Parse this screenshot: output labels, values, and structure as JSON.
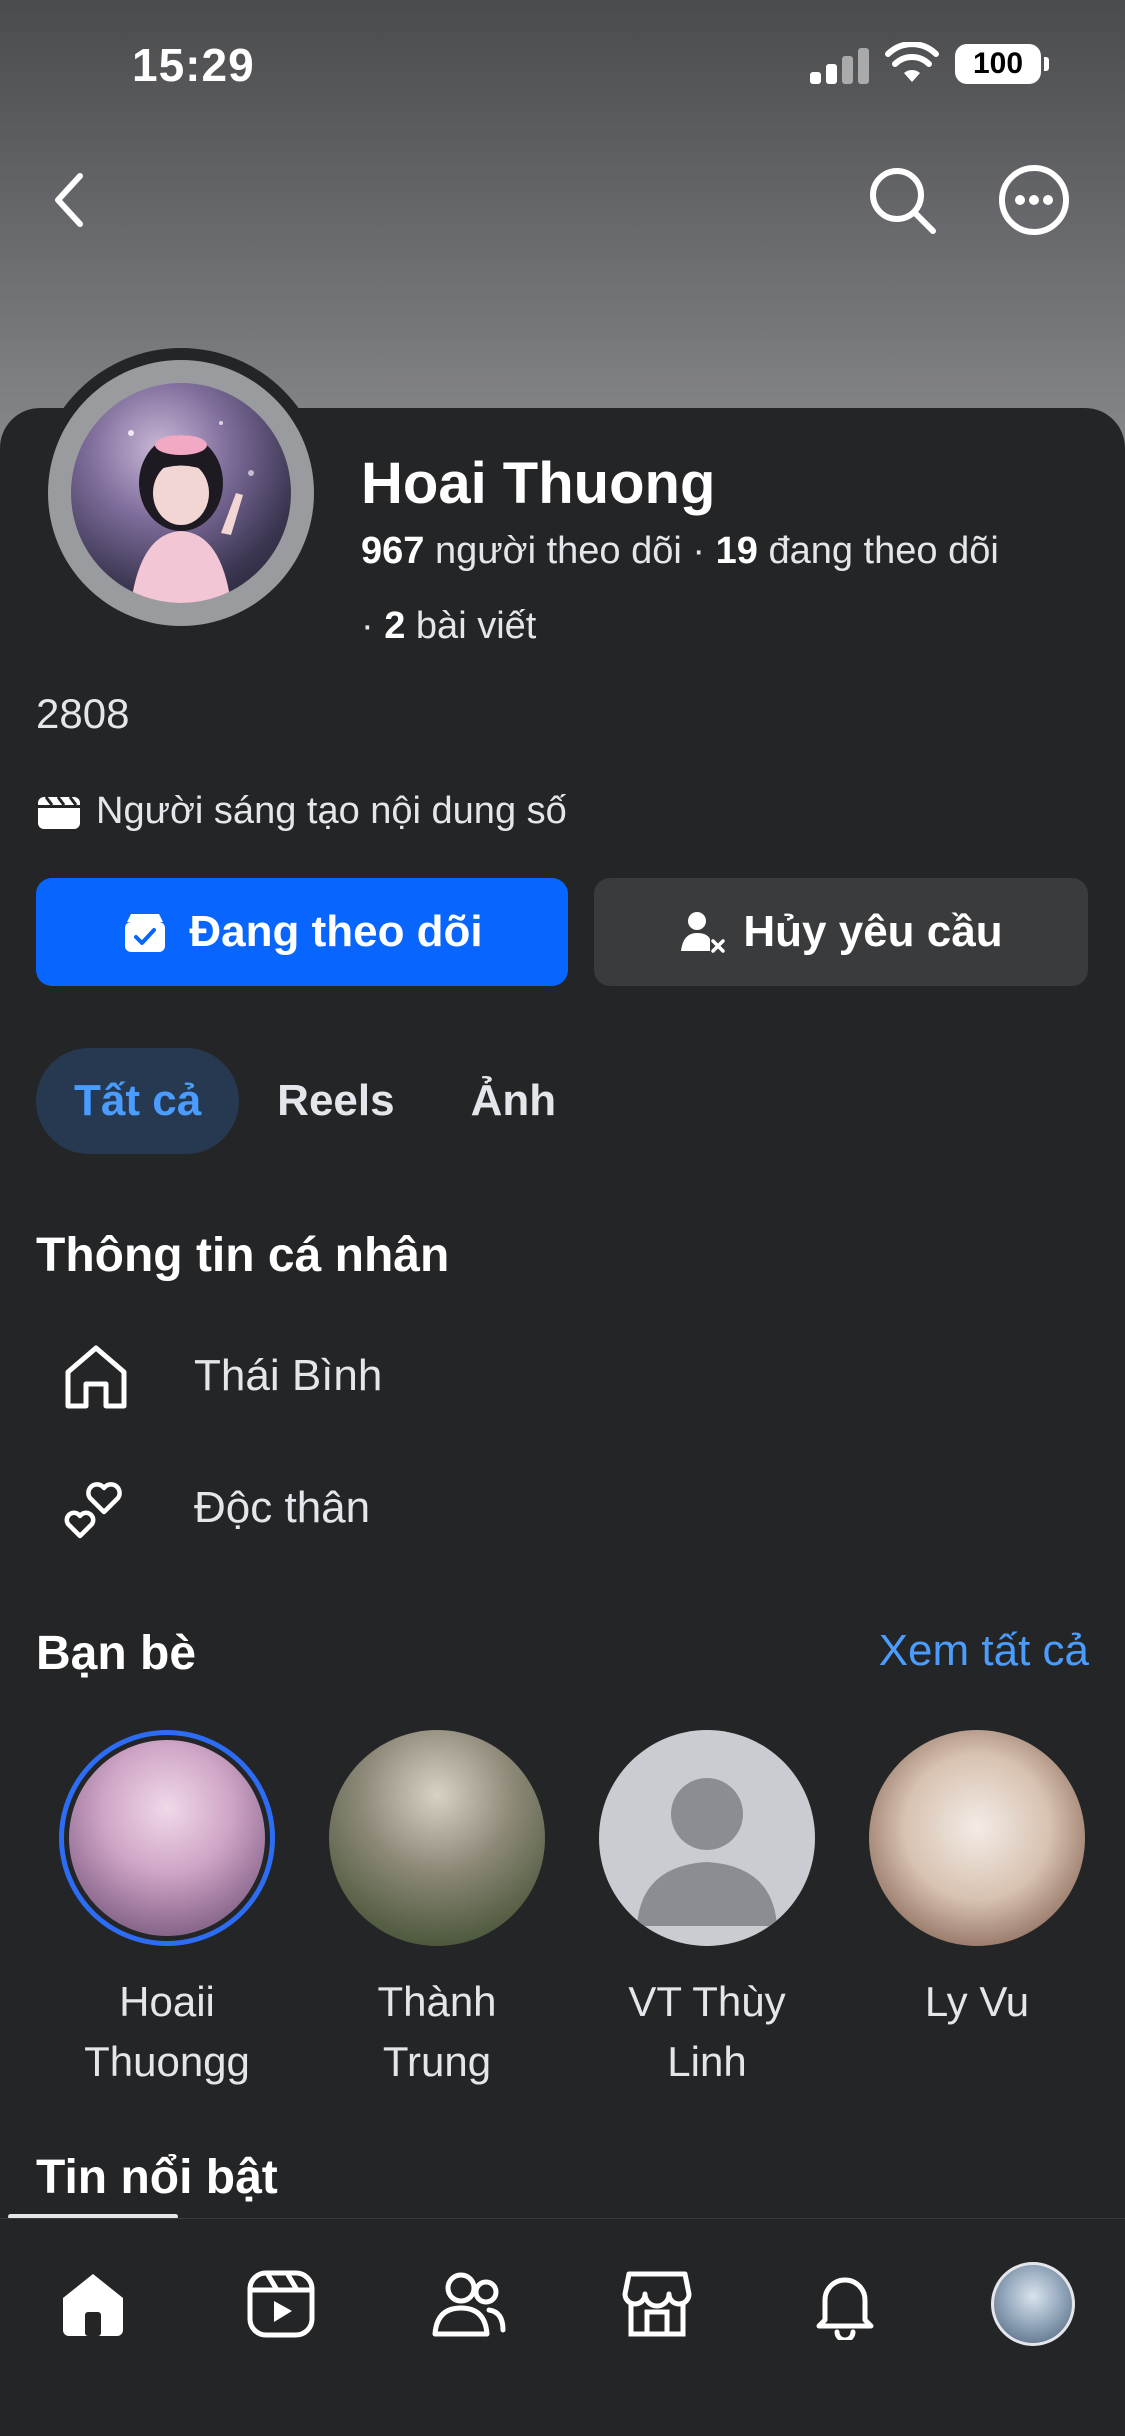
{
  "status_bar": {
    "time": "15:29",
    "battery": "100"
  },
  "header": {
    "back_icon": "chevron-left-icon",
    "search_icon": "search-icon",
    "more_icon": "more-horizontal-icon"
  },
  "profile": {
    "name": "Hoai Thuong",
    "followers_count": "967",
    "followers_label": "người theo dõi",
    "following_count": "19",
    "following_label": "đang theo dõi",
    "posts_count": "2",
    "posts_label": "bài viết",
    "bio": "2808",
    "creator_label": "Người sáng tạo nội dung số"
  },
  "actions": {
    "follow_label": "Đang theo dõi",
    "cancel_label": "Hủy yêu cầu"
  },
  "tabs": [
    {
      "label": "Tất cả",
      "active": true
    },
    {
      "label": "Reels",
      "active": false
    },
    {
      "label": "Ảnh",
      "active": false
    }
  ],
  "personal_info": {
    "title": "Thông tin cá nhân",
    "items": [
      {
        "icon": "home-icon",
        "label": "Thái Bình"
      },
      {
        "icon": "hearts-icon",
        "label": "Độc thân"
      }
    ]
  },
  "friends": {
    "title": "Bạn bè",
    "see_all": "Xem tất cả",
    "items": [
      {
        "name_line1": "Hoaii",
        "name_line2": "Thuongg"
      },
      {
        "name_line1": "Thành",
        "name_line2": "Trung"
      },
      {
        "name_line1": "VT Thùy",
        "name_line2": "Linh"
      },
      {
        "name_line1": "Ly Vu",
        "name_line2": ""
      }
    ]
  },
  "highlights": {
    "title": "Tin nổi bật"
  },
  "bottom_nav": [
    {
      "icon": "home-icon",
      "active": true
    },
    {
      "icon": "reels-icon",
      "active": false
    },
    {
      "icon": "friends-icon",
      "active": false
    },
    {
      "icon": "marketplace-icon",
      "active": false
    },
    {
      "icon": "bell-icon",
      "active": false
    },
    {
      "icon": "profile-avatar-icon",
      "active": false
    }
  ],
  "colors": {
    "background": "#242526",
    "primary_button": "#0866ff",
    "secondary_button": "#3a3b3c",
    "active_tab_bg": "#263951",
    "link": "#4a9cff"
  }
}
